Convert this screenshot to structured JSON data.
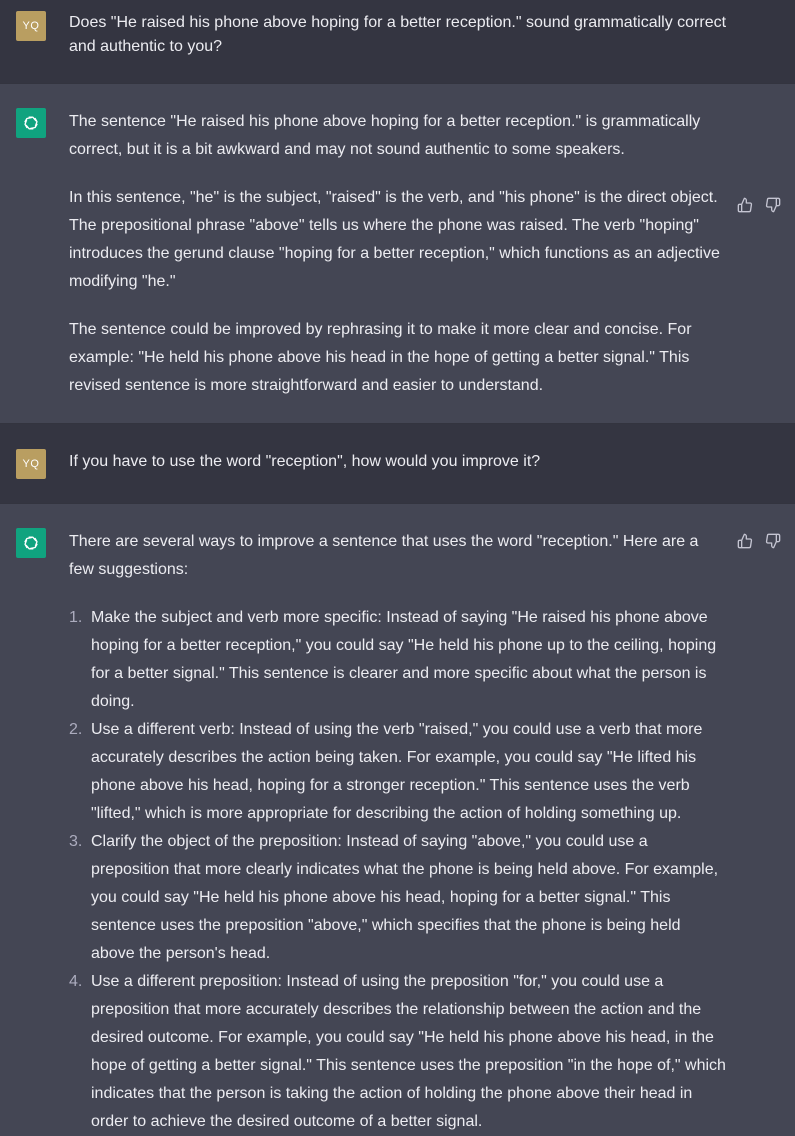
{
  "conversation": [
    {
      "role": "user",
      "avatar_initials": "YQ",
      "text": "Does \"He raised his phone above hoping for a better reception.\" sound grammatically correct and authentic to you?"
    },
    {
      "role": "assistant",
      "paragraphs": [
        "The sentence \"He raised his phone above hoping for a better reception.\" is grammatically correct, but it is a bit awkward and may not sound authentic to some speakers.",
        "In this sentence, \"he\" is the subject, \"raised\" is the verb, and \"his phone\" is the direct object. The prepositional phrase \"above\" tells us where the phone was raised. The verb \"hoping\" introduces the gerund clause \"hoping for a better reception,\" which functions as an adjective modifying \"he.\"",
        "The sentence could be improved by rephrasing it to make it more clear and concise. For example: \"He held his phone above his head in the hope of getting a better signal.\" This revised sentence is more straightforward and easier to understand."
      ]
    },
    {
      "role": "user",
      "avatar_initials": "YQ",
      "text": "If you have to use the word \"reception\", how would you improve it?"
    },
    {
      "role": "assistant",
      "intro": "There are several ways to improve a sentence that uses the word \"reception.\" Here are a few suggestions:",
      "list": [
        {
          "number": "1.",
          "text": "Make the subject and verb more specific: Instead of saying \"He raised his phone above hoping for a better reception,\" you could say \"He held his phone up to the ceiling, hoping for a better signal.\" This sentence is clearer and more specific about what the person is doing."
        },
        {
          "number": "2.",
          "text": "Use a different verb: Instead of using the verb \"raised,\" you could use a verb that more accurately describes the action being taken. For example, you could say \"He lifted his phone above his head, hoping for a stronger reception.\" This sentence uses the verb \"lifted,\" which is more appropriate for describing the action of holding something up."
        },
        {
          "number": "3.",
          "text": "Clarify the object of the preposition: Instead of saying \"above,\" you could use a preposition that more clearly indicates what the phone is being held above. For example, you could say \"He held his phone above his head, hoping for a better signal.\" This sentence uses the preposition \"above,\" which specifies that the phone is being held above the person's head."
        },
        {
          "number": "4.",
          "text": "Use a different preposition: Instead of using the preposition \"for,\" you could use a preposition that more accurately describes the relationship between the action and the desired outcome. For example, you could say \"He held his phone above his head, in the hope of getting a better signal.\" This sentence uses the preposition \"in the hope of,\" which indicates that the person is taking the action of holding the phone above their head in order to achieve the desired outcome of a better signal."
        }
      ]
    }
  ],
  "icons": {
    "assistant_avatar": "openai-logo-icon",
    "feedback_up": "thumbs-up-icon",
    "feedback_down": "thumbs-down-icon"
  },
  "colors": {
    "user_bg": "#343541",
    "assistant_bg": "#444654",
    "user_avatar": "#b99e61",
    "assistant_avatar": "#10a37f",
    "text": "#ececf1"
  }
}
